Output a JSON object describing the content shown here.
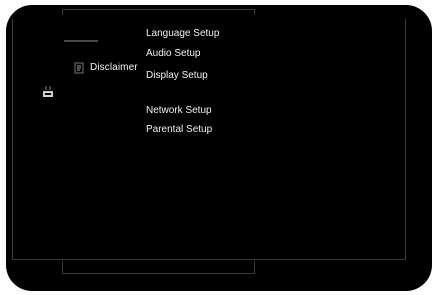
{
  "sidebar": {
    "disclaimer_label": "Disclaimer"
  },
  "setup_menu": {
    "items": [
      {
        "label": "Language Setup"
      },
      {
        "label": "Audio Setup"
      },
      {
        "label": "Display Setup"
      },
      {
        "label": "Network Setup"
      },
      {
        "label": "Parental Setup"
      }
    ]
  }
}
